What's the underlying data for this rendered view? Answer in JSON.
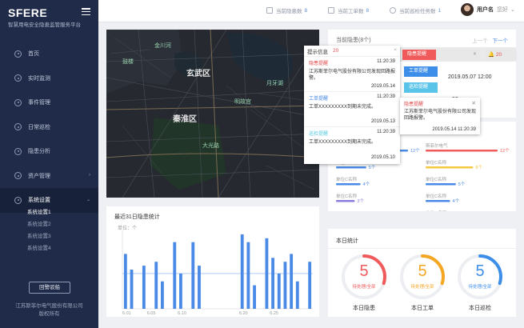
{
  "brand": {
    "title": "SFERE",
    "subtitle": "智慧用电安全隐患监管服务平台"
  },
  "nav": [
    {
      "label": "首页",
      "icon": "home-icon"
    },
    {
      "label": "实时监测",
      "icon": "monitor-icon"
    },
    {
      "label": "事件管理",
      "icon": "event-icon"
    },
    {
      "label": "日常巡检",
      "icon": "inspection-icon"
    },
    {
      "label": "隐患分析",
      "icon": "analysis-icon"
    },
    {
      "label": "资产管理",
      "icon": "asset-icon",
      "chevron": "›"
    },
    {
      "label": "系统设置",
      "icon": "settings-icon",
      "chevron": "⌄",
      "active": true
    }
  ],
  "subnav": [
    "系统设置1",
    "系统设置2",
    "系统设置3",
    "系统设置4"
  ],
  "alarm_button": "回警驳船",
  "copyright": [
    "江苏斯菲尔电气股份有限公司",
    "版权所有"
  ],
  "topbar": {
    "stats": [
      {
        "label": "当前隐患数",
        "value": "8",
        "icon": "warning-icon"
      },
      {
        "label": "当前工单数",
        "value": "8",
        "icon": "ticket-icon"
      },
      {
        "label": "当前巡检任务数",
        "value": "1",
        "icon": "location-icon"
      }
    ],
    "user_name": "用户名",
    "greeting": "您好",
    "user_chevron": "⌄"
  },
  "map": {
    "labels": [
      "玄武区",
      "秦淮区",
      "鼓楼",
      "金川河",
      "月牙湖",
      "明故宫",
      "大光路"
    ]
  },
  "popup": {
    "title": "提示信息",
    "count": "20",
    "items": [
      {
        "type": "隐患提醒",
        "type_color": "#e34d4d",
        "time": "11:20:39",
        "msg": "江苏斯菲尔电气股份有限公司发现回路报警。",
        "date": "2019.05.14"
      },
      {
        "type": "工单提醒",
        "type_color": "#4a8ae6",
        "time": "11:20:39",
        "msg": "工单XXXXXXXXX到期未完成。",
        "date": "2019.05.13"
      },
      {
        "type": "巡检提醒",
        "type_color": "#5ac8e0",
        "time": "11:20:39",
        "msg": "工单XXXXXXXXX到期未完成。",
        "date": "2019.05.10"
      }
    ]
  },
  "detail_popup": {
    "type": "隐患提醒",
    "msg": "江苏斯菲尔电气股份有限公司发现回路报警。",
    "date": "2019.05.14",
    "time": "11:20:39"
  },
  "tags": [
    {
      "label": "隐患提醒",
      "color": "#f05a5a"
    },
    {
      "label": "工单提醒",
      "color": "#3d8ee8"
    },
    {
      "label": "巡检提醒",
      "color": "#5ac3e8"
    }
  ],
  "hidden_card": {
    "title": "当前隐患(8个)",
    "pager_prev": "上一个",
    "pager_next": "下一个",
    "count_badge": "20",
    "date": "2019.05.07 12:00",
    "partial_number": "93"
  },
  "ranking": {
    "left": [
      {
        "label": "",
        "value": "12个",
        "color": "#4a8ae6",
        "fraction": 1.0
      },
      {
        "label": "单位C名称",
        "value": "5个",
        "color": "#4a8ae6",
        "fraction": 0.42
      },
      {
        "label": "单位C名称",
        "value": "4个",
        "color": "#4a8ae6",
        "fraction": 0.34
      },
      {
        "label": "单位C名称",
        "value": "3个",
        "color": "#8a7de0",
        "fraction": 0.26
      }
    ],
    "right": [
      {
        "label": "斯菲尔电气",
        "value": "12个",
        "color": "#f05a5a",
        "fraction": 1.0
      },
      {
        "label": "单位C名称",
        "value": "8个",
        "color": "#f5c842",
        "fraction": 0.66
      },
      {
        "label": "单位C名称",
        "value": "5个",
        "color": "#4a8ae6",
        "fraction": 0.42
      },
      {
        "label": "单位C名称",
        "value": "4个",
        "color": "#4a8ae6",
        "fraction": 0.34
      },
      {
        "label": "单位C名称",
        "value": "3个",
        "color": "#8a7de0",
        "fraction": 0.26
      }
    ]
  },
  "chart_data": {
    "type": "bar",
    "title": "最近31日隐患统计",
    "unit_label": "单位：个",
    "ylim": [
      0,
      20
    ],
    "avg_line": 9,
    "x_tick_labels": [
      "6.01",
      "6.05",
      "6.10",
      "6.20",
      "6.25"
    ],
    "values": [
      14,
      10,
      0,
      11,
      0,
      12,
      7,
      0,
      17,
      9,
      0,
      17,
      11,
      0,
      0,
      0,
      0,
      0,
      0,
      19,
      17,
      6,
      0,
      18,
      13,
      9,
      12,
      14,
      7,
      0,
      12
    ],
    "color": "#4a8ae6"
  },
  "today": {
    "title": "本日统计",
    "rings": [
      {
        "value": "5",
        "sub": "待处理/全部",
        "label": "本日隐患",
        "color": "#f05a5a",
        "fraction": 0.3
      },
      {
        "value": "5",
        "sub": "待处理/全部",
        "label": "本日工单",
        "color": "#f5a623",
        "fraction": 0.3
      },
      {
        "value": "5",
        "sub": "待处理/全部",
        "label": "本日巡检",
        "color": "#3d8ee8",
        "fraction": 0.3
      }
    ]
  }
}
